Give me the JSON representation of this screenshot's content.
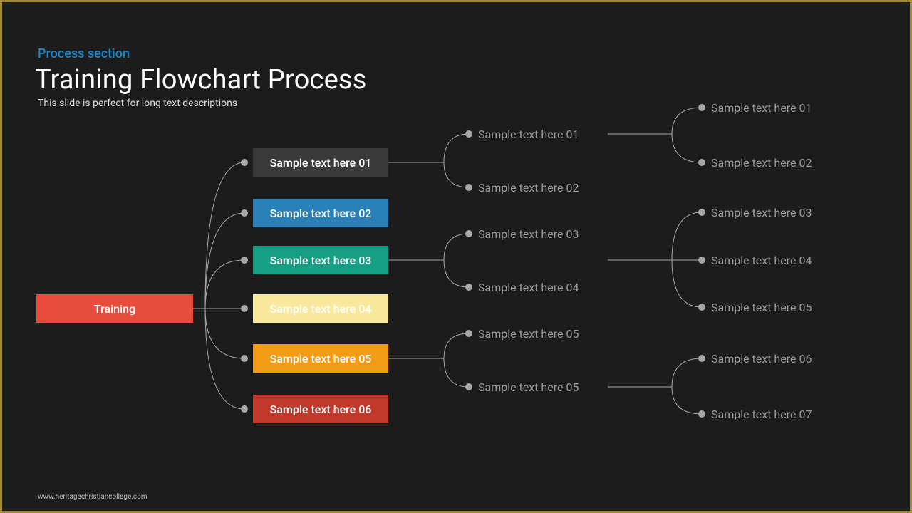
{
  "header": {
    "section": "Process section",
    "title": "Training Flowchart Process",
    "subtitle": "This slide is perfect for long text descriptions"
  },
  "root": {
    "label": "Training"
  },
  "level1": {
    "b1": "Sample text here 01",
    "b2": "Sample text here 02",
    "b3": "Sample text here 03",
    "b4": "Sample text here 04",
    "b5": "Sample text here 05",
    "b6": "Sample text here 06"
  },
  "level2": {
    "g1a": "Sample text here 01",
    "g1b": "Sample text here 02",
    "g2a": "Sample text here 03",
    "g2b": "Sample text here 04",
    "g3a": "Sample text here 05",
    "g3b": "Sample text here 05"
  },
  "level3": {
    "r1": "Sample text here 01",
    "r2": "Sample text here 02",
    "r3": "Sample text here 03",
    "r4": "Sample text here 04",
    "r5": "Sample text here 05",
    "r6": "Sample text here 06",
    "r7": "Sample text here 07"
  },
  "footer": "www.heritagechristiancollege.com"
}
